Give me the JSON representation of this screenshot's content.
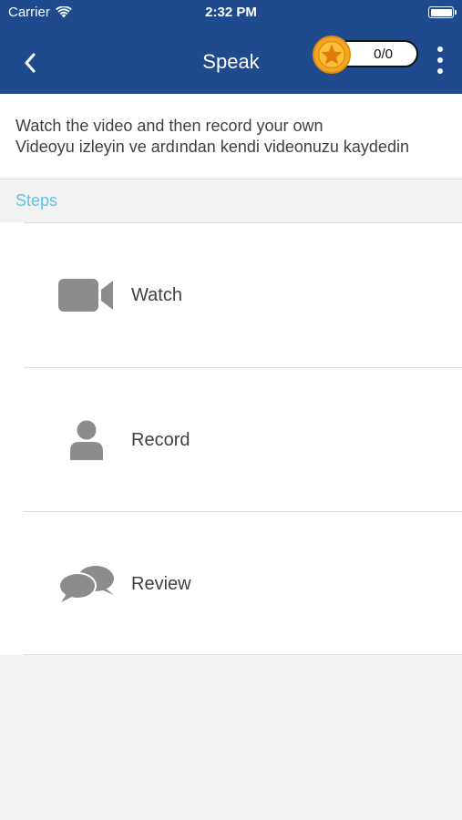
{
  "status_bar": {
    "carrier": "Carrier",
    "time": "2:32 PM"
  },
  "nav": {
    "title": "Speak",
    "score": "0/0"
  },
  "instructions": {
    "line1": "Watch the video and then record your own",
    "line2": "Videoyu izleyin ve ardından kendi videonuzu kaydedin"
  },
  "section": {
    "label": "Steps"
  },
  "steps": [
    {
      "label": "Watch",
      "icon": "video-camera-icon"
    },
    {
      "label": "Record",
      "icon": "person-icon"
    },
    {
      "label": "Review",
      "icon": "chat-bubbles-icon"
    }
  ],
  "colors": {
    "nav_bg": "#1f4b8e",
    "accent": "#5bc5e8",
    "icon_gray": "#8c8c8c",
    "coin": "#f5a623"
  }
}
